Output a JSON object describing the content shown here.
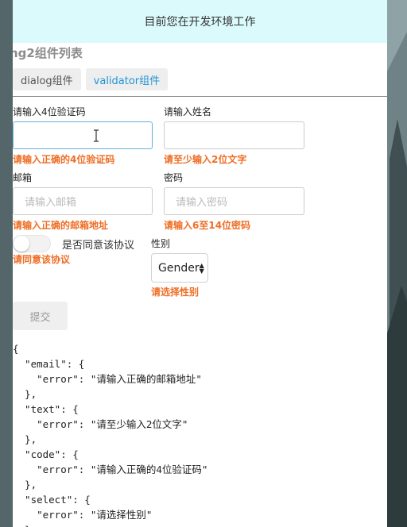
{
  "env_banner": "目前您在开发环境工作",
  "page_title": "ng2组件列表",
  "tabs": [
    {
      "label": "dialog组件"
    },
    {
      "label": "validator组件"
    }
  ],
  "form": {
    "code": {
      "label": "请输入4位验证码",
      "value": "",
      "error": "请输入正确的4位验证码"
    },
    "name": {
      "label": "请输入姓名",
      "value": "",
      "error": "请至少输入2位文字"
    },
    "email": {
      "label": "邮箱",
      "placeholder": "请输入邮箱",
      "error": "请输入正确的邮箱地址"
    },
    "password": {
      "label": "密码",
      "placeholder": "请输入密码",
      "error": "请输入6至14位密码"
    },
    "agree": {
      "label": "是否同意该协议",
      "checked": false,
      "error": "请同意该协议"
    },
    "gender": {
      "label": "性别",
      "selected": "Gender",
      "error": "请选择性别"
    },
    "submit_label": "提交"
  },
  "json_output": "{\n  \"email\": {\n    \"error\": \"请输入正确的邮箱地址\"\n  },\n  \"text\": {\n    \"error\": \"请至少输入2位文字\"\n  },\n  \"code\": {\n    \"error\": \"请输入正确的4位验证码\"\n  },\n  \"select\": {\n    \"error\": \"请选择性别\"\n  }\n}"
}
